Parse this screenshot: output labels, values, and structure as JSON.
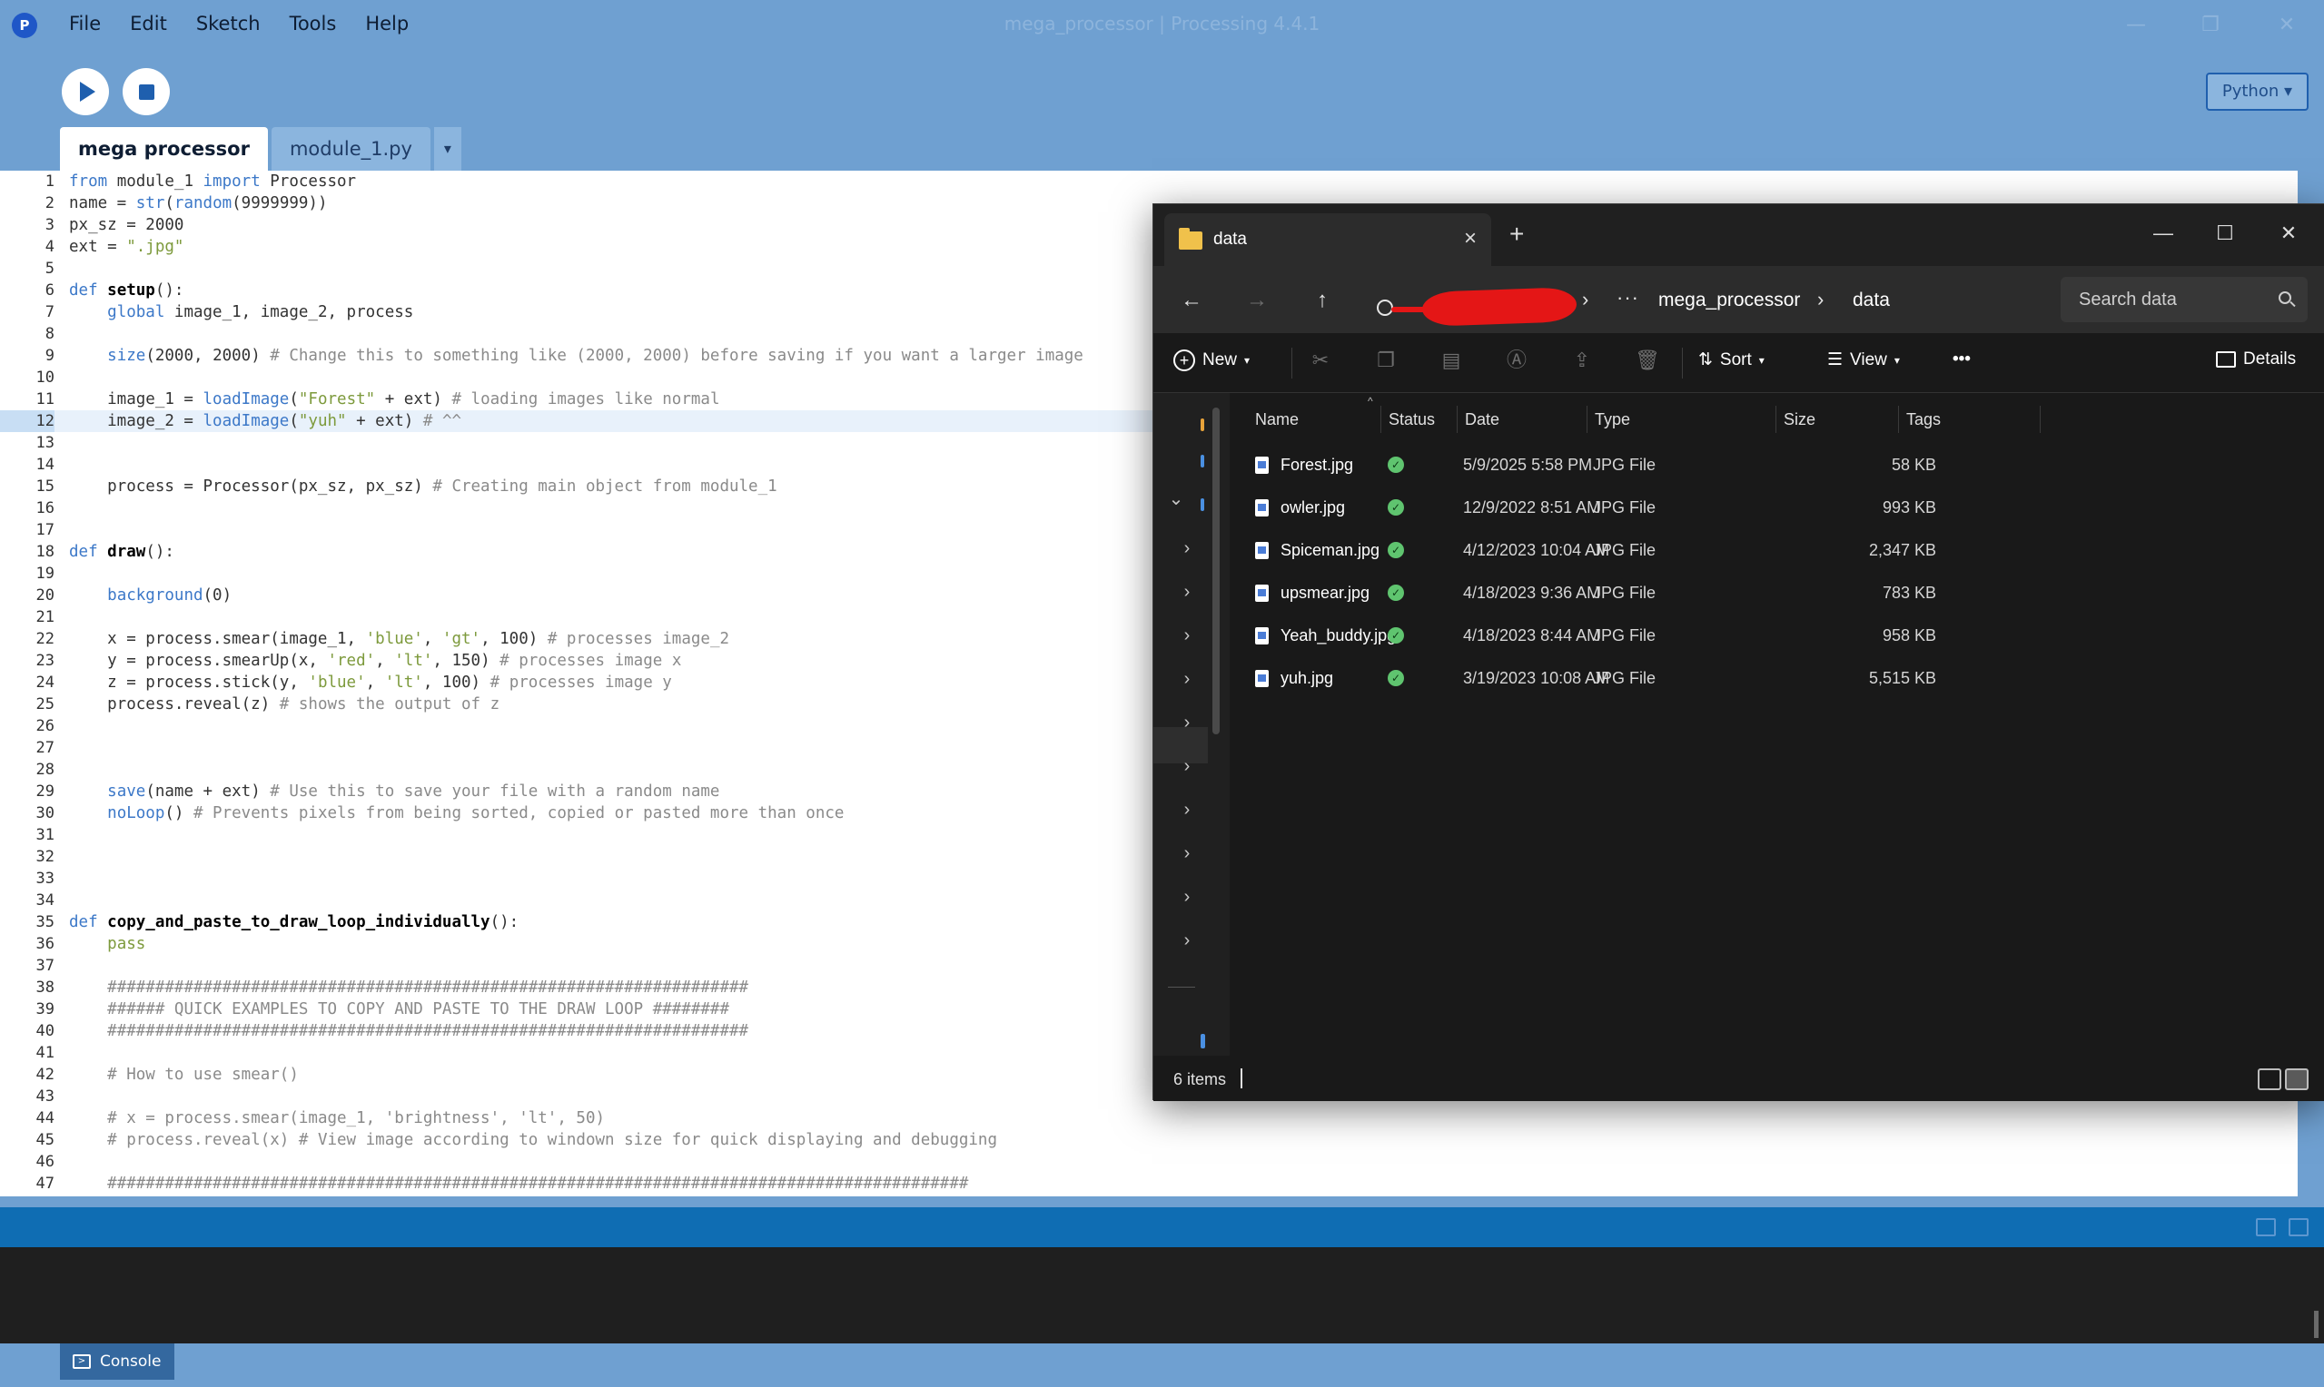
{
  "ide": {
    "title": "mega_processor | Processing 4.4.1",
    "menu": [
      "File",
      "Edit",
      "Sketch",
      "Tools",
      "Help"
    ],
    "mode_label": "Python ▾",
    "tabs": {
      "active": "mega processor",
      "other": "module_1.py",
      "menu_arrow": "▾"
    },
    "console_label": "Console",
    "window_controls": {
      "minimize": "—",
      "maximize": "❐",
      "close": "✕"
    }
  },
  "code_lines": [
    "from module_1 import Processor",
    "name = str(random(9999999))",
    "px_sz = 2000",
    "ext = \".jpg\"",
    "",
    "def setup():",
    "    global image_1, image_2, process",
    "",
    "    size(2000, 2000) # Change this to something like (2000, 2000) before saving if you want a larger image",
    "",
    "    image_1 = loadImage(\"Forest\" + ext) # loading images like normal",
    "    image_2 = loadImage(\"yuh\" + ext) # ^^",
    "",
    "",
    "    process = Processor(px_sz, px_sz) # Creating main object from module_1",
    "",
    "",
    "def draw():",
    "",
    "    background(0)",
    "",
    "    x = process.smear(image_1, 'blue', 'gt', 100) # processes image_2",
    "    y = process.smearUp(x, 'red', 'lt', 150) # processes image x",
    "    z = process.stick(y, 'blue', 'lt', 100) # processes image y",
    "    process.reveal(z) # shows the output of z",
    "",
    "",
    "",
    "    save(name + ext) # Use this to save your file with a random name",
    "    noLoop() # Prevents pixels from being sorted, copied or pasted more than once",
    "",
    "",
    "",
    "",
    "def copy_and_paste_to_draw_loop_individually():",
    "    pass",
    "",
    "    ###################################################################",
    "    ###### QUICK EXAMPLES TO COPY AND PASTE TO THE DRAW LOOP ########",
    "    ###################################################################",
    "",
    "    # How to use smear()",
    "",
    "    # x = process.smear(image_1, 'brightness', 'lt', 50)",
    "    # process.reveal(x) # View image according to windown size for quick displaying and debugging",
    "",
    "    ##########################################################################################"
  ],
  "active_line": 12,
  "explorer": {
    "tab_title": "data",
    "path": [
      "mega_processor",
      "data"
    ],
    "path_more": "···",
    "search_placeholder": "Search data",
    "commands": {
      "new": "New",
      "sort": "Sort",
      "view": "View",
      "more": "•••",
      "details": "Details"
    },
    "columns": [
      "Name",
      "Status",
      "Date",
      "Type",
      "Size",
      "Tags"
    ],
    "files": [
      {
        "name": "Forest.jpg",
        "date": "5/9/2025 5:58 PM",
        "type": "JPG File",
        "size": "58 KB"
      },
      {
        "name": "owler.jpg",
        "date": "12/9/2022 8:51 AM",
        "type": "JPG File",
        "size": "993 KB"
      },
      {
        "name": "Spiceman.jpg",
        "date": "4/12/2023 10:04 AM",
        "type": "JPG File",
        "size": "2,347 KB"
      },
      {
        "name": "upsmear.jpg",
        "date": "4/18/2023 9:36 AM",
        "type": "JPG File",
        "size": "783 KB"
      },
      {
        "name": "Yeah_buddy.jpg",
        "date": "4/18/2023 8:44 AM",
        "type": "JPG File",
        "size": "958 KB"
      },
      {
        "name": "yuh.jpg",
        "date": "3/19/2023 10:08 AM",
        "type": "JPG File",
        "size": "5,515 KB"
      }
    ],
    "status_text": "6 items"
  }
}
